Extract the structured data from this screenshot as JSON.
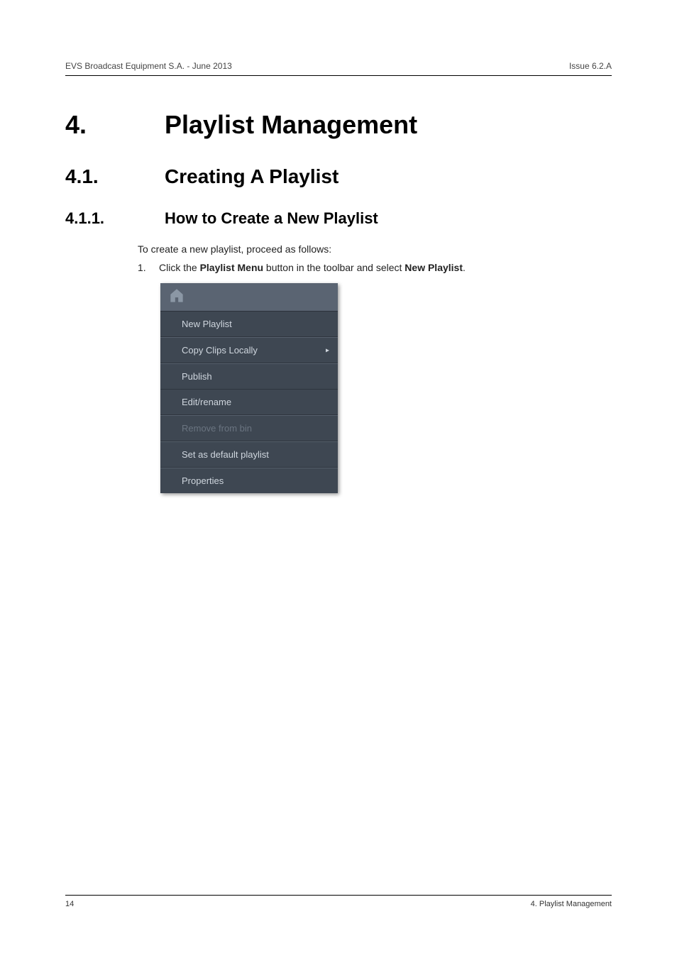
{
  "header": {
    "left": "EVS Broadcast Equipment S.A. - June 2013",
    "right": "Issue 6.2.A"
  },
  "h1": {
    "num": "4.",
    "text": "Playlist Management"
  },
  "h2": {
    "num": "4.1.",
    "text": "Creating A Playlist"
  },
  "h3": {
    "num": "4.1.1.",
    "text": "How to Create a New Playlist"
  },
  "intro": "To create a new playlist, proceed as follows:",
  "step": {
    "num": "1.",
    "pre": "Click the ",
    "b1": "Playlist Menu",
    "mid": " button in the toolbar and select ",
    "b2": "New Playlist",
    "post": "."
  },
  "menu": {
    "items": [
      {
        "label": "New Playlist",
        "disabled": false,
        "arrow": false
      },
      {
        "label": "Copy Clips Locally",
        "disabled": false,
        "arrow": true
      },
      {
        "label": "Publish",
        "disabled": false,
        "arrow": false
      },
      {
        "label": "Edit/rename",
        "disabled": false,
        "arrow": false
      },
      {
        "label": "Remove from bin",
        "disabled": true,
        "arrow": false
      },
      {
        "label": "Set as default playlist",
        "disabled": false,
        "arrow": false
      },
      {
        "label": "Properties",
        "disabled": false,
        "arrow": false
      }
    ]
  },
  "footer": {
    "left": "14",
    "right": "4. Playlist Management"
  }
}
